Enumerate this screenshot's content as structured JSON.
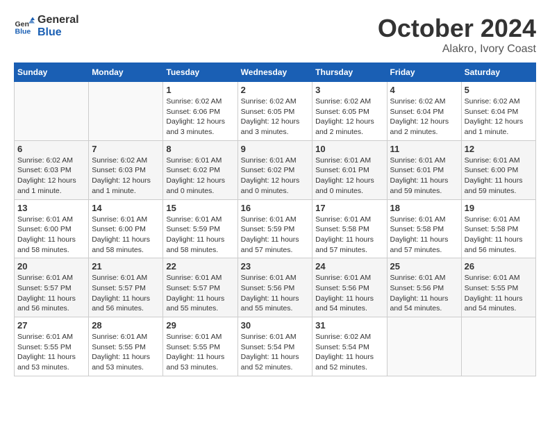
{
  "header": {
    "logo_line1": "General",
    "logo_line2": "Blue",
    "month": "October 2024",
    "location": "Alakro, Ivory Coast"
  },
  "weekdays": [
    "Sunday",
    "Monday",
    "Tuesday",
    "Wednesday",
    "Thursday",
    "Friday",
    "Saturday"
  ],
  "weeks": [
    [
      {
        "day": "",
        "info": ""
      },
      {
        "day": "",
        "info": ""
      },
      {
        "day": "1",
        "info": "Sunrise: 6:02 AM\nSunset: 6:06 PM\nDaylight: 12 hours and 3 minutes."
      },
      {
        "day": "2",
        "info": "Sunrise: 6:02 AM\nSunset: 6:05 PM\nDaylight: 12 hours and 3 minutes."
      },
      {
        "day": "3",
        "info": "Sunrise: 6:02 AM\nSunset: 6:05 PM\nDaylight: 12 hours and 2 minutes."
      },
      {
        "day": "4",
        "info": "Sunrise: 6:02 AM\nSunset: 6:04 PM\nDaylight: 12 hours and 2 minutes."
      },
      {
        "day": "5",
        "info": "Sunrise: 6:02 AM\nSunset: 6:04 PM\nDaylight: 12 hours and 1 minute."
      }
    ],
    [
      {
        "day": "6",
        "info": "Sunrise: 6:02 AM\nSunset: 6:03 PM\nDaylight: 12 hours and 1 minute."
      },
      {
        "day": "7",
        "info": "Sunrise: 6:02 AM\nSunset: 6:03 PM\nDaylight: 12 hours and 1 minute."
      },
      {
        "day": "8",
        "info": "Sunrise: 6:01 AM\nSunset: 6:02 PM\nDaylight: 12 hours and 0 minutes."
      },
      {
        "day": "9",
        "info": "Sunrise: 6:01 AM\nSunset: 6:02 PM\nDaylight: 12 hours and 0 minutes."
      },
      {
        "day": "10",
        "info": "Sunrise: 6:01 AM\nSunset: 6:01 PM\nDaylight: 12 hours and 0 minutes."
      },
      {
        "day": "11",
        "info": "Sunrise: 6:01 AM\nSunset: 6:01 PM\nDaylight: 11 hours and 59 minutes."
      },
      {
        "day": "12",
        "info": "Sunrise: 6:01 AM\nSunset: 6:00 PM\nDaylight: 11 hours and 59 minutes."
      }
    ],
    [
      {
        "day": "13",
        "info": "Sunrise: 6:01 AM\nSunset: 6:00 PM\nDaylight: 11 hours and 58 minutes."
      },
      {
        "day": "14",
        "info": "Sunrise: 6:01 AM\nSunset: 6:00 PM\nDaylight: 11 hours and 58 minutes."
      },
      {
        "day": "15",
        "info": "Sunrise: 6:01 AM\nSunset: 5:59 PM\nDaylight: 11 hours and 58 minutes."
      },
      {
        "day": "16",
        "info": "Sunrise: 6:01 AM\nSunset: 5:59 PM\nDaylight: 11 hours and 57 minutes."
      },
      {
        "day": "17",
        "info": "Sunrise: 6:01 AM\nSunset: 5:58 PM\nDaylight: 11 hours and 57 minutes."
      },
      {
        "day": "18",
        "info": "Sunrise: 6:01 AM\nSunset: 5:58 PM\nDaylight: 11 hours and 57 minutes."
      },
      {
        "day": "19",
        "info": "Sunrise: 6:01 AM\nSunset: 5:58 PM\nDaylight: 11 hours and 56 minutes."
      }
    ],
    [
      {
        "day": "20",
        "info": "Sunrise: 6:01 AM\nSunset: 5:57 PM\nDaylight: 11 hours and 56 minutes."
      },
      {
        "day": "21",
        "info": "Sunrise: 6:01 AM\nSunset: 5:57 PM\nDaylight: 11 hours and 56 minutes."
      },
      {
        "day": "22",
        "info": "Sunrise: 6:01 AM\nSunset: 5:57 PM\nDaylight: 11 hours and 55 minutes."
      },
      {
        "day": "23",
        "info": "Sunrise: 6:01 AM\nSunset: 5:56 PM\nDaylight: 11 hours and 55 minutes."
      },
      {
        "day": "24",
        "info": "Sunrise: 6:01 AM\nSunset: 5:56 PM\nDaylight: 11 hours and 54 minutes."
      },
      {
        "day": "25",
        "info": "Sunrise: 6:01 AM\nSunset: 5:56 PM\nDaylight: 11 hours and 54 minutes."
      },
      {
        "day": "26",
        "info": "Sunrise: 6:01 AM\nSunset: 5:55 PM\nDaylight: 11 hours and 54 minutes."
      }
    ],
    [
      {
        "day": "27",
        "info": "Sunrise: 6:01 AM\nSunset: 5:55 PM\nDaylight: 11 hours and 53 minutes."
      },
      {
        "day": "28",
        "info": "Sunrise: 6:01 AM\nSunset: 5:55 PM\nDaylight: 11 hours and 53 minutes."
      },
      {
        "day": "29",
        "info": "Sunrise: 6:01 AM\nSunset: 5:55 PM\nDaylight: 11 hours and 53 minutes."
      },
      {
        "day": "30",
        "info": "Sunrise: 6:01 AM\nSunset: 5:54 PM\nDaylight: 11 hours and 52 minutes."
      },
      {
        "day": "31",
        "info": "Sunrise: 6:02 AM\nSunset: 5:54 PM\nDaylight: 11 hours and 52 minutes."
      },
      {
        "day": "",
        "info": ""
      },
      {
        "day": "",
        "info": ""
      }
    ]
  ]
}
